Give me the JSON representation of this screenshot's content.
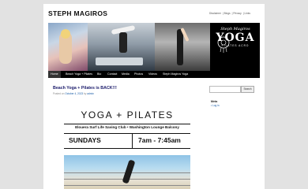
{
  "site": {
    "title": "STEPH MAGIROS"
  },
  "top_links": [
    "Disclaimer",
    "Blogs",
    "Privacy",
    "Links"
  ],
  "banner": {
    "logo_script": "Steph Magiros",
    "logo_main": "YOGA",
    "logo_sub": "PILATES ACRO"
  },
  "nav": [
    "Home",
    "Beach Yoga + Pilates",
    "Bio",
    "Contact",
    "Media",
    "Photos",
    "Videos",
    "Steph Magiros Yoga"
  ],
  "post": {
    "title": "Beach Yoga + Pilates is BACK!!!",
    "meta_prefix": "Posted on",
    "date": "October 4, 2023",
    "meta_by": "by",
    "author": "admin"
  },
  "poster": {
    "heading": "YOGA + PILATES",
    "subheading": "Elouera Surf Life Saving Club • Washington Lounge Balcony",
    "day": "SUNDAYS",
    "time": "7am - 7:45am"
  },
  "sidebar": {
    "search_button": "Search",
    "meta_heading": "Meta",
    "meta_link": "Log in"
  }
}
